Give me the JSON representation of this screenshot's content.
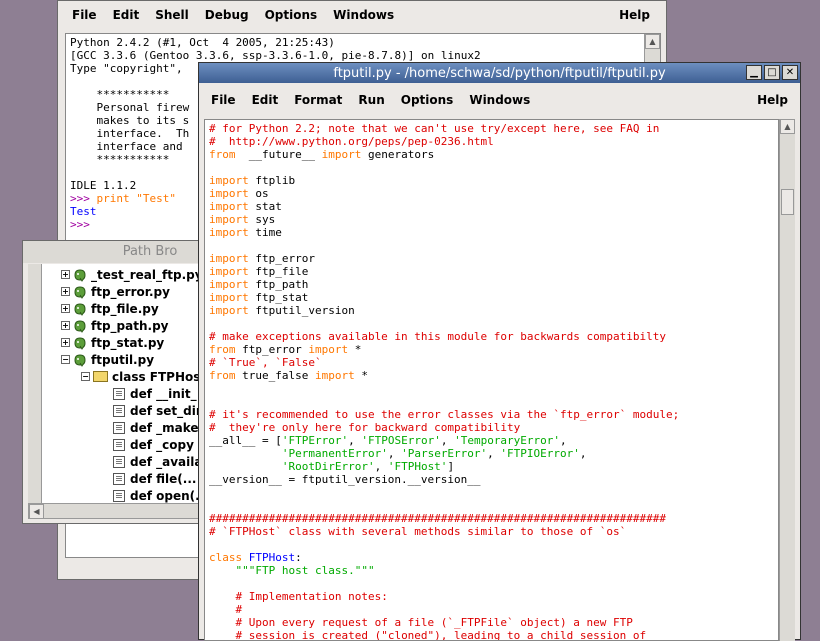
{
  "shell": {
    "menu": [
      "File",
      "Edit",
      "Shell",
      "Debug",
      "Options",
      "Windows"
    ],
    "help": "Help",
    "lines": [
      "Python 2.4.2 (#1, Oct  4 2005, 21:25:43)",
      "[GCC 3.3.6 (Gentoo 3.3.6, ssp-3.3.6-1.0, pie-8.7.8)] on linux2",
      "Type \"copyright\", ",
      "",
      "    ***********",
      "    Personal firew",
      "    makes to its s",
      "    interface.  Th",
      "    interface and ",
      "    ***********",
      "",
      "IDLE 1.1.2"
    ],
    "prompt1": ">>> ",
    "cmd": "print \"Test\"",
    "output": "Test",
    "prompt2": ">>> "
  },
  "browser": {
    "title": "Path Bro",
    "items": [
      {
        "label": "_test_real_ftp.py",
        "kind": "py",
        "sign": "+"
      },
      {
        "label": "ftp_error.py",
        "kind": "py",
        "sign": "+"
      },
      {
        "label": "ftp_file.py",
        "kind": "py",
        "sign": "+"
      },
      {
        "label": "ftp_path.py",
        "kind": "py",
        "sign": "+"
      },
      {
        "label": "ftp_stat.py",
        "kind": "py",
        "sign": "+"
      },
      {
        "label": "ftputil.py",
        "kind": "py",
        "sign": "-"
      },
      {
        "label": "class FTPHost",
        "kind": "class",
        "sign": "-"
      },
      {
        "label": "def __init_",
        "kind": "def"
      },
      {
        "label": "def set_dir",
        "kind": "def"
      },
      {
        "label": "def _make",
        "kind": "def"
      },
      {
        "label": "def _copy",
        "kind": "def"
      },
      {
        "label": "def _availa",
        "kind": "def"
      },
      {
        "label": "def file(...",
        "kind": "def"
      },
      {
        "label": "def open(.",
        "kind": "def"
      }
    ]
  },
  "editor": {
    "title": "ftputil.py - /home/schwa/sd/python/ftputil/ftputil.py",
    "menu": [
      "File",
      "Edit",
      "Format",
      "Run",
      "Options",
      "Windows"
    ],
    "help": "Help",
    "code": [
      [
        [
          "cm",
          "# for Python 2.2; note that we can't use try/except here, see FAQ in"
        ]
      ],
      [
        [
          "cm",
          "#  http://www.python.org/peps/pep-0236.html"
        ]
      ],
      [
        [
          "kw",
          "from"
        ],
        [
          "",
          "  __future__ "
        ],
        [
          "kw",
          "import"
        ],
        [
          "",
          " generators"
        ]
      ],
      [],
      [
        [
          "kw",
          "import"
        ],
        [
          "",
          " ftplib"
        ]
      ],
      [
        [
          "kw",
          "import"
        ],
        [
          "",
          " os"
        ]
      ],
      [
        [
          "kw",
          "import"
        ],
        [
          "",
          " stat"
        ]
      ],
      [
        [
          "kw",
          "import"
        ],
        [
          "",
          " sys"
        ]
      ],
      [
        [
          "kw",
          "import"
        ],
        [
          "",
          " time"
        ]
      ],
      [],
      [
        [
          "kw",
          "import"
        ],
        [
          "",
          " ftp_error"
        ]
      ],
      [
        [
          "kw",
          "import"
        ],
        [
          "",
          " ftp_file"
        ]
      ],
      [
        [
          "kw",
          "import"
        ],
        [
          "",
          " ftp_path"
        ]
      ],
      [
        [
          "kw",
          "import"
        ],
        [
          "",
          " ftp_stat"
        ]
      ],
      [
        [
          "kw",
          "import"
        ],
        [
          "",
          " ftputil_version"
        ]
      ],
      [],
      [
        [
          "cm",
          "# make exceptions available in this module for backwards compatibilty"
        ]
      ],
      [
        [
          "kw",
          "from"
        ],
        [
          "",
          " ftp_error "
        ],
        [
          "kw",
          "import"
        ],
        [
          "",
          " *"
        ]
      ],
      [
        [
          "cm",
          "# `True`, `False`"
        ]
      ],
      [
        [
          "kw",
          "from"
        ],
        [
          "",
          " true_false "
        ],
        [
          "kw",
          "import"
        ],
        [
          "",
          " *"
        ]
      ],
      [],
      [],
      [
        [
          "cm",
          "# it's recommended to use the error classes via the `ftp_error` module;"
        ]
      ],
      [
        [
          "cm",
          "#  they're only here for backward compatibility"
        ]
      ],
      [
        [
          "",
          "__all__ = ["
        ],
        [
          "st",
          "'FTPError'"
        ],
        [
          "",
          ", "
        ],
        [
          "st",
          "'FTPOSError'"
        ],
        [
          "",
          ", "
        ],
        [
          "st",
          "'TemporaryError'"
        ],
        [
          "",
          ","
        ]
      ],
      [
        [
          "",
          "           "
        ],
        [
          "st",
          "'PermanentError'"
        ],
        [
          "",
          ", "
        ],
        [
          "st",
          "'ParserError'"
        ],
        [
          "",
          ", "
        ],
        [
          "st",
          "'FTPIOError'"
        ],
        [
          "",
          ","
        ]
      ],
      [
        [
          "",
          "           "
        ],
        [
          "st",
          "'RootDirError'"
        ],
        [
          "",
          ", "
        ],
        [
          "st",
          "'FTPHost'"
        ],
        [
          "",
          "]"
        ]
      ],
      [
        [
          "",
          "__version__ = ftputil_version.__version__"
        ]
      ],
      [],
      [],
      [
        [
          "cm",
          "#####################################################################"
        ]
      ],
      [
        [
          "cm",
          "# `FTPHost` class with several methods similar to those of `os`"
        ]
      ],
      [],
      [
        [
          "kw",
          "class"
        ],
        [
          "",
          " "
        ],
        [
          "nm",
          "FTPHost"
        ],
        [
          "",
          ":"
        ]
      ],
      [
        [
          "",
          "    "
        ],
        [
          "st",
          "\"\"\"FTP host class.\"\"\""
        ]
      ],
      [],
      [
        [
          "",
          "    "
        ],
        [
          "cm",
          "# Implementation notes:"
        ]
      ],
      [
        [
          "",
          "    "
        ],
        [
          "cm",
          "#"
        ]
      ],
      [
        [
          "",
          "    "
        ],
        [
          "cm",
          "# Upon every request of a file (`_FTPFile` object) a new FTP"
        ]
      ],
      [
        [
          "",
          "    "
        ],
        [
          "cm",
          "# session is created (\"cloned\"), leading to a child session of"
        ]
      ]
    ]
  }
}
